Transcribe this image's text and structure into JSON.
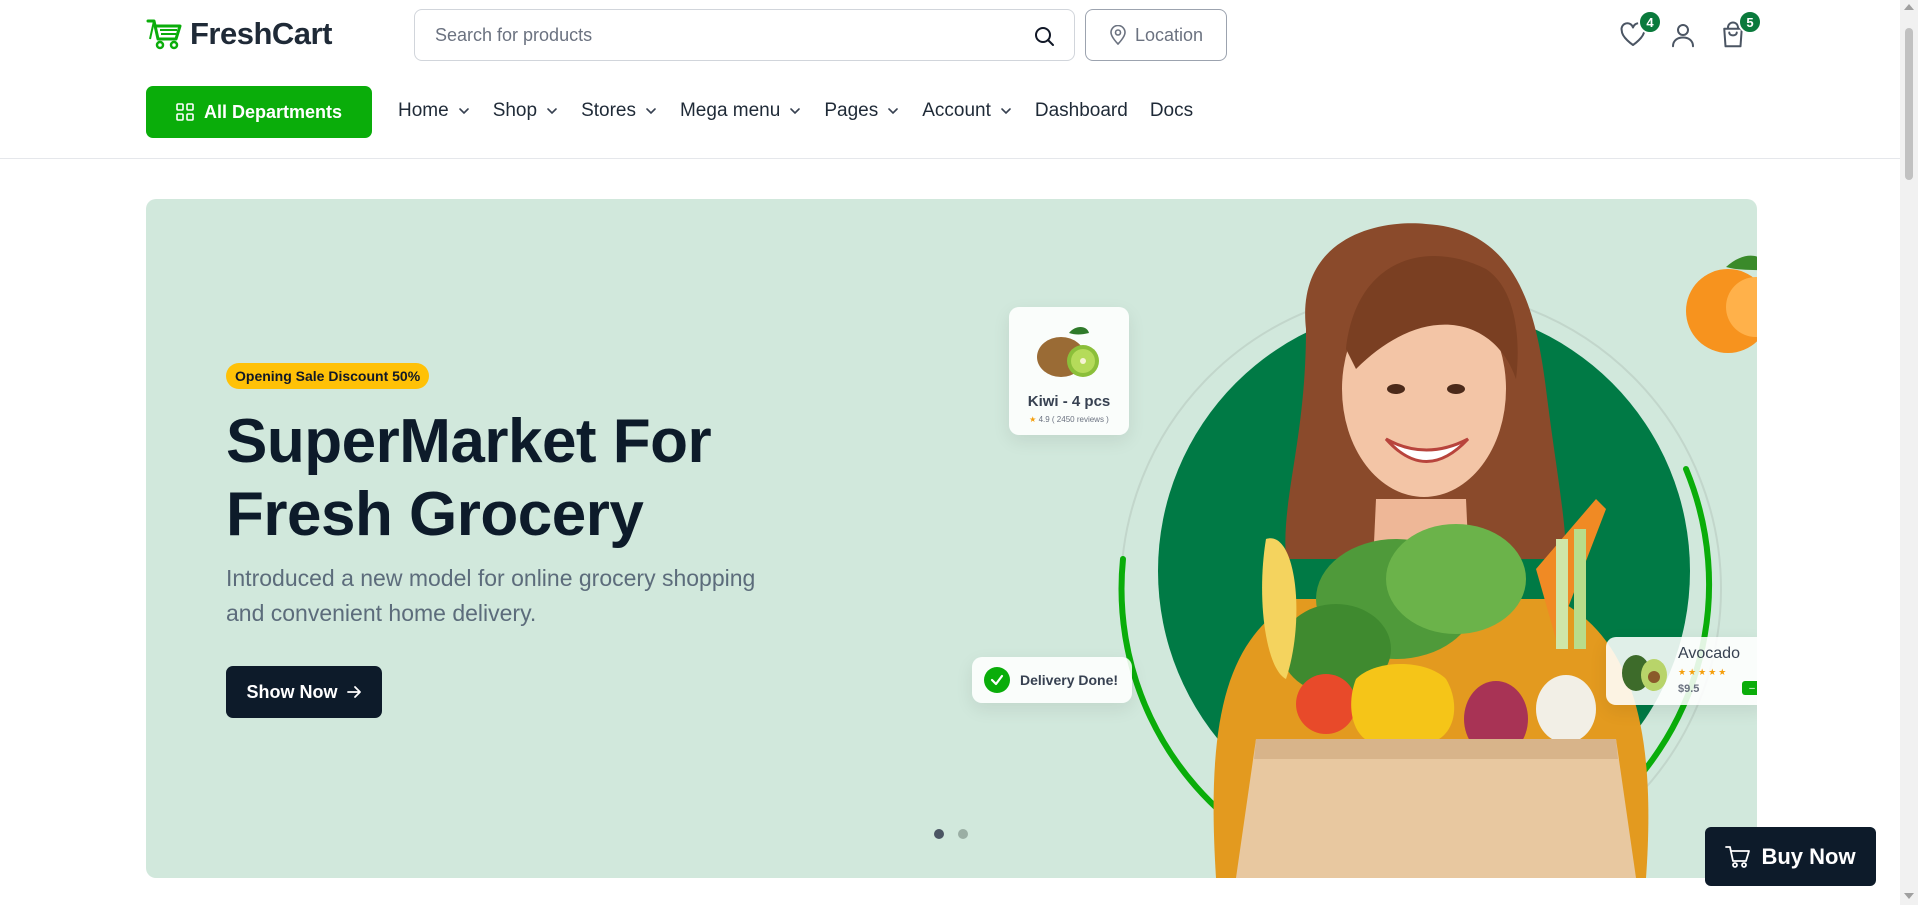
{
  "brand": {
    "name": "FreshCart",
    "accent": "#0aad0a",
    "dark": "#0d1b2a",
    "badge_color": "#0a7a3c"
  },
  "header": {
    "search": {
      "placeholder": "Search for products",
      "value": ""
    },
    "location_label": "Location",
    "wishlist_count": "4",
    "cart_count": "5"
  },
  "nav": {
    "departments_label": "All Departments",
    "items": [
      {
        "label": "Home",
        "dropdown": true
      },
      {
        "label": "Shop",
        "dropdown": true
      },
      {
        "label": "Stores",
        "dropdown": true
      },
      {
        "label": "Mega menu",
        "dropdown": true
      },
      {
        "label": "Pages",
        "dropdown": true
      },
      {
        "label": "Account",
        "dropdown": true
      },
      {
        "label": "Dashboard",
        "dropdown": false
      },
      {
        "label": "Docs",
        "dropdown": false
      }
    ]
  },
  "hero": {
    "badge": "Opening Sale Discount 50%",
    "title_line1": "SuperMarket For",
    "title_line2": "Fresh Grocery",
    "subtitle_line1": "Introduced a new model for online grocery shopping",
    "subtitle_line2": "and convenient home delivery.",
    "cta_label": "Show Now",
    "background": "#d1e8dc",
    "slides": {
      "count": 2,
      "active": 0
    },
    "kiwi_card": {
      "name": "Kiwi - 4 pcs",
      "rating": "4.9",
      "reviews": "( 2450 reviews )"
    },
    "delivery_card": {
      "label": "Delivery Done!"
    },
    "avocado_card": {
      "name": "Avocado",
      "stars": "★★★★★",
      "price": "$9.5",
      "add": "–"
    }
  },
  "floating": {
    "buy_now_label": "Buy Now"
  }
}
